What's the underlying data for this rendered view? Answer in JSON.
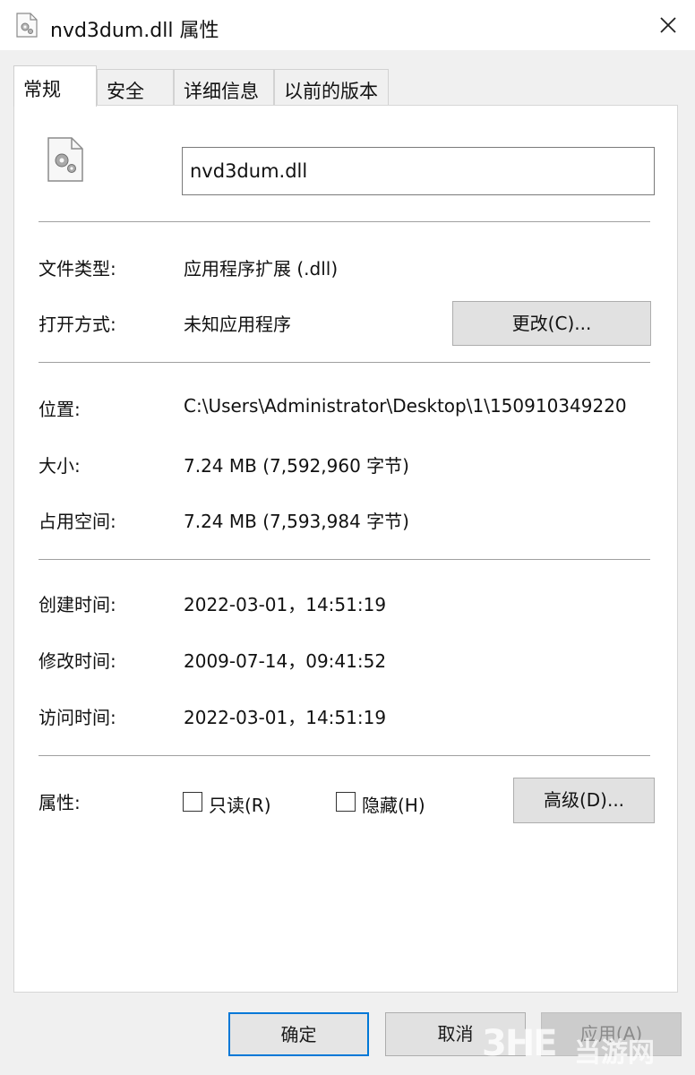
{
  "window": {
    "title": "nvd3dum.dll 属性"
  },
  "tabs": [
    {
      "label": "常规",
      "active": true
    },
    {
      "label": "安全",
      "active": false
    },
    {
      "label": "详细信息",
      "active": false
    },
    {
      "label": "以前的版本",
      "active": false
    }
  ],
  "general": {
    "file_name": "nvd3dum.dll",
    "file_type_label": "文件类型:",
    "file_type_value": "应用程序扩展 (.dll)",
    "opens_with_label": "打开方式:",
    "opens_with_value": "未知应用程序",
    "change_button": "更改(C)...",
    "location_label": "位置:",
    "location_value": "C:\\Users\\Administrator\\Desktop\\1\\150910349220",
    "size_label": "大小:",
    "size_value": "7.24 MB (7,592,960 字节)",
    "size_on_disk_label": "占用空间:",
    "size_on_disk_value": "7.24 MB (7,593,984 字节)",
    "created_label": "创建时间:",
    "created_value": "2022-03-01，14:51:19",
    "modified_label": "修改时间:",
    "modified_value": "2009-07-14，09:41:52",
    "accessed_label": "访问时间:",
    "accessed_value": "2022-03-01，14:51:19",
    "attributes_label": "属性:",
    "readonly_label": "只读(R)",
    "readonly_checked": false,
    "hidden_label": "隐藏(H)",
    "hidden_checked": false,
    "advanced_button": "高级(D)..."
  },
  "footer": {
    "ok_button": "确定",
    "cancel_button": "取消",
    "apply_button": "应用(A)"
  },
  "watermark": {
    "logo": "3HE",
    "text": "当游网"
  },
  "colors": {
    "focus_border": "#0078d7",
    "panel_bg": "#ffffff",
    "dialog_bg": "#f0f0f0"
  }
}
